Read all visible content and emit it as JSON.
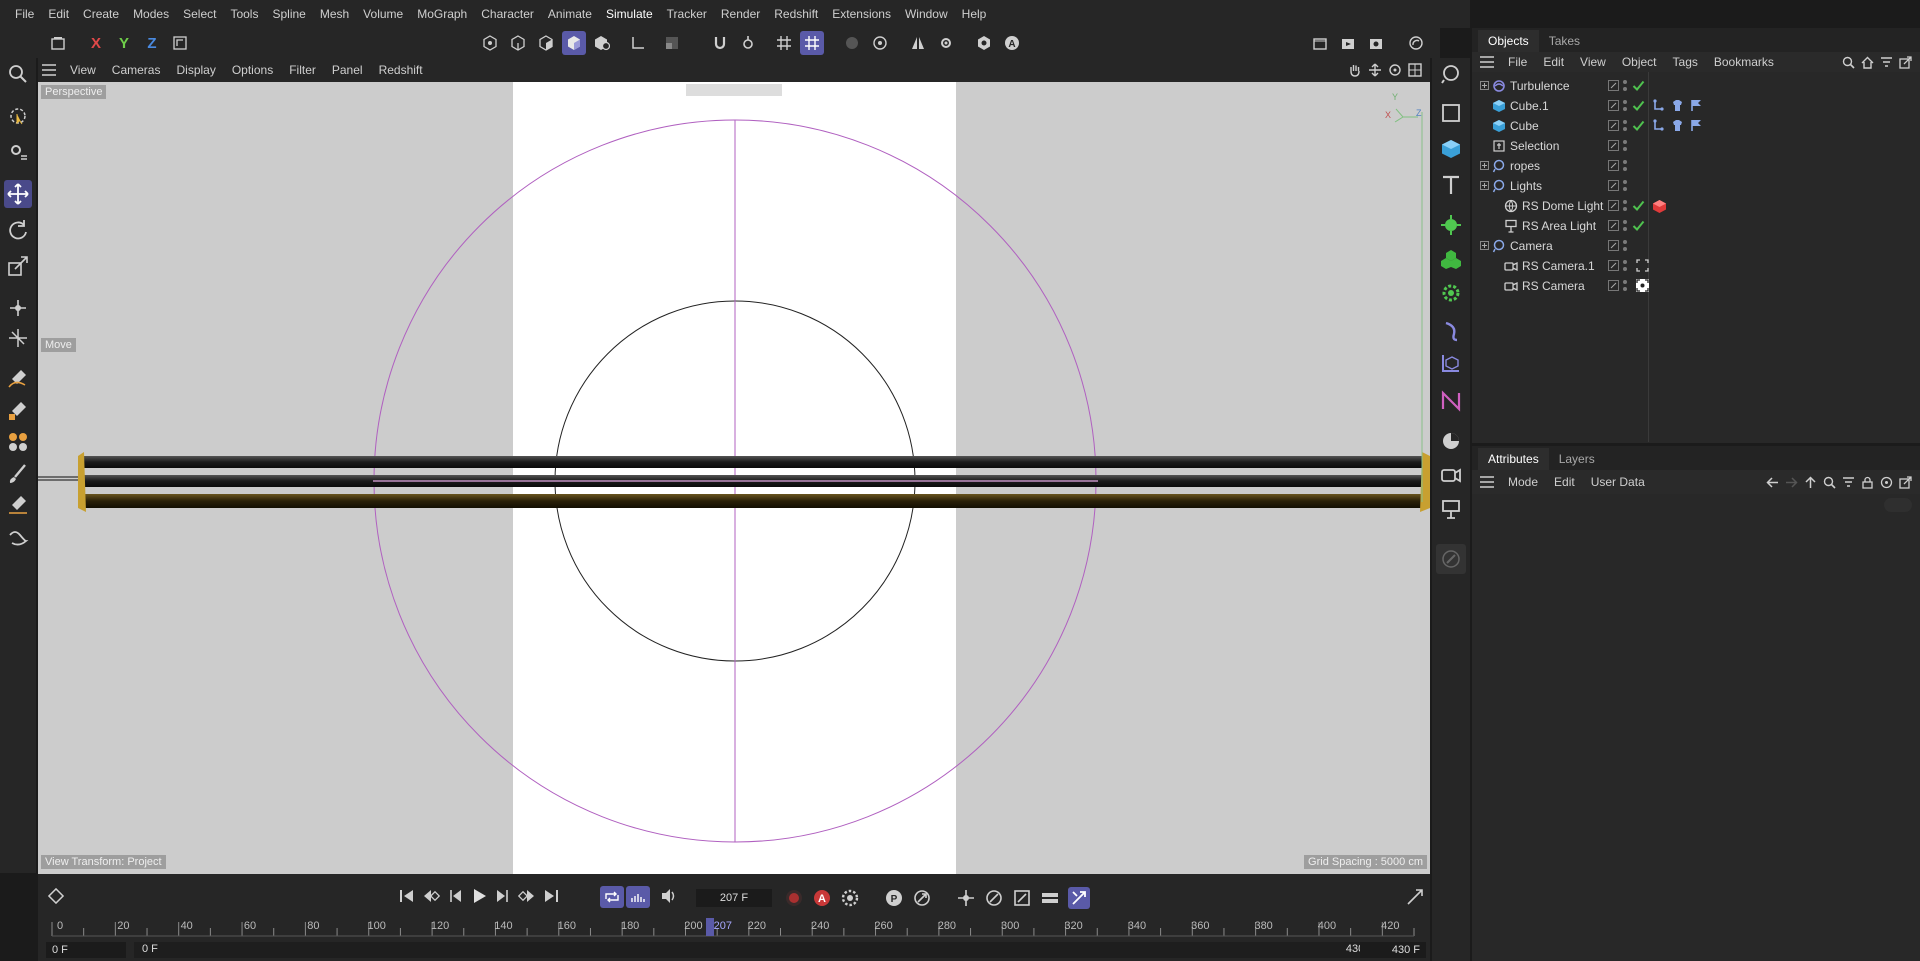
{
  "menu": [
    "File",
    "Edit",
    "Create",
    "Modes",
    "Select",
    "Tools",
    "Spline",
    "Mesh",
    "Volume",
    "MoGraph",
    "Character",
    "Animate",
    "Simulate",
    "Tracker",
    "Render",
    "Redshift",
    "Extensions",
    "Window",
    "Help"
  ],
  "toolbar": {
    "axis_x": "X",
    "axis_y": "Y",
    "axis_z": "Z"
  },
  "viewport": {
    "menu": [
      "View",
      "Cameras",
      "Display",
      "Options",
      "Filter",
      "Panel",
      "Redshift"
    ],
    "view_label": "Perspective",
    "tool_label": "Move",
    "view_transform": "View Transform: Project",
    "grid_spacing": "Grid Spacing : 5000 cm",
    "axis_y": "Y",
    "axis_x": "X",
    "axis_z": "Z"
  },
  "objects": {
    "tabs": [
      "Objects",
      "Takes"
    ],
    "menu": [
      "File",
      "Edit",
      "View",
      "Object",
      "Tags",
      "Bookmarks"
    ],
    "items": [
      {
        "name": "Turbulence",
        "icon": "turbulence-icon",
        "indent": 0,
        "expand": true,
        "check": true,
        "tags": []
      },
      {
        "name": "Cube.1",
        "icon": "cube-icon",
        "indent": 0,
        "expand": false,
        "check": true,
        "tags": [
          "tag-a",
          "tag-b",
          "tag-c"
        ]
      },
      {
        "name": "Cube",
        "icon": "cube-icon",
        "indent": 0,
        "expand": false,
        "check": true,
        "tags": [
          "tag-a",
          "tag-b",
          "tag-c"
        ]
      },
      {
        "name": "Selection",
        "icon": "selection-icon",
        "indent": 0,
        "expand": false,
        "check": false,
        "tags": []
      },
      {
        "name": "ropes",
        "icon": "null-icon",
        "indent": 0,
        "expand": true,
        "check": false,
        "tags": []
      },
      {
        "name": "Lights",
        "icon": "null-icon",
        "indent": 0,
        "expand": true,
        "check": false,
        "tags": []
      },
      {
        "name": "RS Dome Light",
        "icon": "dome-light-icon",
        "indent": 1,
        "expand": false,
        "check": true,
        "tags": [
          "red-cube-tag"
        ]
      },
      {
        "name": "RS Area Light",
        "icon": "area-light-icon",
        "indent": 1,
        "expand": false,
        "check": true,
        "tags": []
      },
      {
        "name": "Camera",
        "icon": "null-icon",
        "indent": 0,
        "expand": true,
        "check": false,
        "tags": []
      },
      {
        "name": "RS Camera.1",
        "icon": "camera-icon",
        "indent": 1,
        "expand": false,
        "check": false,
        "tags": [
          "target-tag"
        ]
      },
      {
        "name": "RS Camera",
        "icon": "camera-icon",
        "indent": 1,
        "expand": false,
        "check": false,
        "tags": [
          "target-tag-active"
        ]
      }
    ]
  },
  "attributes": {
    "tabs": [
      "Attributes",
      "Layers"
    ],
    "menu": [
      "Mode",
      "Edit",
      "User Data"
    ]
  },
  "timeline": {
    "current_frame": "207 F",
    "current_frame_marker": "207",
    "ticks": [
      0,
      20,
      40,
      60,
      80,
      100,
      120,
      140,
      160,
      180,
      200,
      220,
      240,
      260,
      280,
      300,
      320,
      340,
      360,
      380,
      400,
      420
    ],
    "max_frame": 430,
    "playhead": 207,
    "start_field": "0 F",
    "min_field": "0 F",
    "max_field": "430 F",
    "end_field": "430 F"
  },
  "colors": {
    "accent": "#5a5aa8",
    "check": "#4fc24f",
    "bg": "#262626",
    "panel": "#282828"
  }
}
